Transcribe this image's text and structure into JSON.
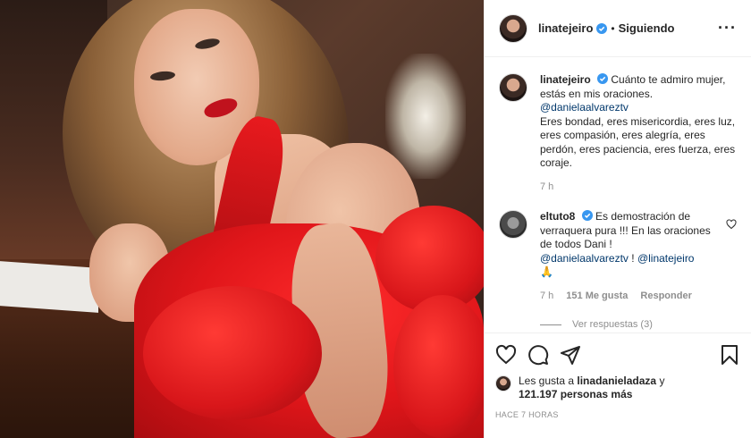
{
  "header": {
    "username": "linatejeiro",
    "separator": "•",
    "follow_status": "Siguiendo",
    "more_icon": "more-horizontal-icon"
  },
  "caption": {
    "username": "linatejeiro",
    "text_1": "Cuánto te admiro mujer, estás en mis oraciones.",
    "mention": "@danielaalvareztv",
    "text_2": "Eres bondad, eres misericordia, eres luz, eres compasión, eres alegría, eres perdón, eres paciencia, eres fuerza, eres coraje.",
    "time": "7 h"
  },
  "comment": {
    "username": "eltuto8",
    "text": "Es demostración de verraquera pura !!! En las oraciones de todos Dani !",
    "mention_1": "@danielaalvareztv",
    "separator": "!",
    "mention_2": "@linatejeiro",
    "emoji": "🙏",
    "time": "7 h",
    "likes": "151 Me gusta",
    "reply": "Responder",
    "view_replies": "Ver respuestas (3)"
  },
  "actions": {
    "like_icon": "heart-icon",
    "comment_icon": "comment-icon",
    "share_icon": "share-icon",
    "save_icon": "bookmark-icon"
  },
  "likes": {
    "prefix": "Les gusta a",
    "user": "linadanieladaza",
    "middle": "y",
    "count": "121.197 personas más"
  },
  "timestamp": "HACE 7 HORAS",
  "colors": {
    "verified": "#3897f0",
    "mention": "#00376b",
    "muted": "#8e8e8e",
    "dress": "#e0161a"
  }
}
